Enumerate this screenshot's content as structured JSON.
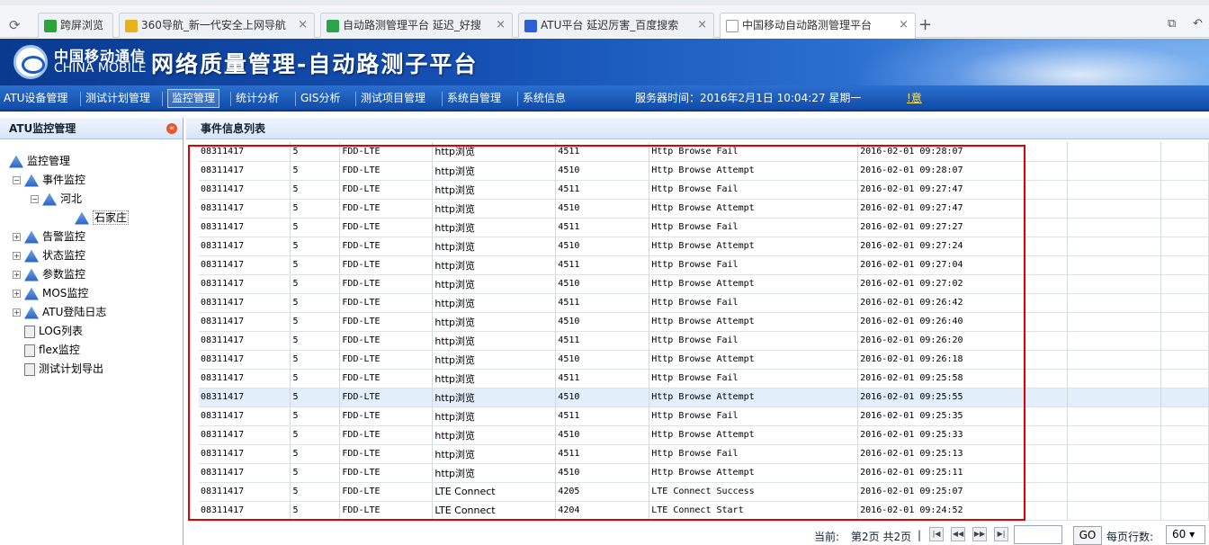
{
  "browser": {
    "tabs": [
      {
        "label": "跨屏浏览",
        "color": "#2ca33b"
      },
      {
        "label": "360导航_新一代安全上网导航",
        "color": "#e8b21a"
      },
      {
        "label": "自动路测管理平台 延迟_好搜",
        "color": "#2ea24a"
      },
      {
        "label": "ATU平台 延迟厉害_百度搜索",
        "color": "#2b5fd6"
      },
      {
        "label": "中国移动自动路测管理平台",
        "color": "#ffffff"
      }
    ]
  },
  "banner": {
    "brand_cn": "中国移动通信",
    "brand_en": "CHINA MOBILE",
    "title": "网络质量管理-自动路测子平台"
  },
  "menu": {
    "items": [
      "ATU设备管理",
      "测试计划管理",
      "监控管理",
      "统计分析",
      "GIS分析",
      "测试项目管理",
      "系统自管理",
      "系统信息"
    ],
    "selected": "监控管理",
    "server_time": "服务器时间：2016年2月1日 10:04:27 星期一",
    "warning": "!意"
  },
  "sidebar": {
    "title": "ATU监控管理",
    "tree": [
      {
        "label": "监控管理",
        "icon": "network-icon",
        "exp": ""
      },
      {
        "label": "事件监控",
        "icon": "network-icon",
        "exp": "−"
      },
      {
        "label": "河北",
        "icon": "network-icon",
        "exp": "−"
      },
      {
        "label": "石家庄",
        "icon": "network-icon",
        "exp": ""
      },
      {
        "label": "告警监控",
        "icon": "network-icon",
        "exp": "+"
      },
      {
        "label": "状态监控",
        "icon": "network-icon",
        "exp": "+"
      },
      {
        "label": "参数监控",
        "icon": "network-icon",
        "exp": "+"
      },
      {
        "label": "MOS监控",
        "icon": "network-icon",
        "exp": "+"
      },
      {
        "label": "ATU登陆日志",
        "icon": "network-icon",
        "exp": "+"
      },
      {
        "label": "LOG列表",
        "icon": "document-icon",
        "exp": ""
      },
      {
        "label": "flex监控",
        "icon": "document-icon",
        "exp": ""
      },
      {
        "label": "测试计划导出",
        "icon": "document-icon",
        "exp": ""
      }
    ]
  },
  "content": {
    "title": "事件信息列表",
    "rows": [
      [
        "08311417",
        "5",
        "FDD-LTE",
        "http浏览",
        "4511",
        "Http Browse Fail",
        "2016-02-01 09:28:07"
      ],
      [
        "08311417",
        "5",
        "FDD-LTE",
        "http浏览",
        "4510",
        "Http Browse Attempt",
        "2016-02-01 09:28:07"
      ],
      [
        "08311417",
        "5",
        "FDD-LTE",
        "http浏览",
        "4511",
        "Http Browse Fail",
        "2016-02-01 09:27:47"
      ],
      [
        "08311417",
        "5",
        "FDD-LTE",
        "http浏览",
        "4510",
        "Http Browse Attempt",
        "2016-02-01 09:27:47"
      ],
      [
        "08311417",
        "5",
        "FDD-LTE",
        "http浏览",
        "4511",
        "Http Browse Fail",
        "2016-02-01 09:27:27"
      ],
      [
        "08311417",
        "5",
        "FDD-LTE",
        "http浏览",
        "4510",
        "Http Browse Attempt",
        "2016-02-01 09:27:24"
      ],
      [
        "08311417",
        "5",
        "FDD-LTE",
        "http浏览",
        "4511",
        "Http Browse Fail",
        "2016-02-01 09:27:04"
      ],
      [
        "08311417",
        "5",
        "FDD-LTE",
        "http浏览",
        "4510",
        "Http Browse Attempt",
        "2016-02-01 09:27:02"
      ],
      [
        "08311417",
        "5",
        "FDD-LTE",
        "http浏览",
        "4511",
        "Http Browse Fail",
        "2016-02-01 09:26:42"
      ],
      [
        "08311417",
        "5",
        "FDD-LTE",
        "http浏览",
        "4510",
        "Http Browse Attempt",
        "2016-02-01 09:26:40"
      ],
      [
        "08311417",
        "5",
        "FDD-LTE",
        "http浏览",
        "4511",
        "Http Browse Fail",
        "2016-02-01 09:26:20"
      ],
      [
        "08311417",
        "5",
        "FDD-LTE",
        "http浏览",
        "4510",
        "Http Browse Attempt",
        "2016-02-01 09:26:18"
      ],
      [
        "08311417",
        "5",
        "FDD-LTE",
        "http浏览",
        "4511",
        "Http Browse Fail",
        "2016-02-01 09:25:58"
      ],
      [
        "08311417",
        "5",
        "FDD-LTE",
        "http浏览",
        "4510",
        "Http Browse Attempt",
        "2016-02-01 09:25:55"
      ],
      [
        "08311417",
        "5",
        "FDD-LTE",
        "http浏览",
        "4511",
        "Http Browse Fail",
        "2016-02-01 09:25:35"
      ],
      [
        "08311417",
        "5",
        "FDD-LTE",
        "http浏览",
        "4510",
        "Http Browse Attempt",
        "2016-02-01 09:25:33"
      ],
      [
        "08311417",
        "5",
        "FDD-LTE",
        "http浏览",
        "4511",
        "Http Browse Fail",
        "2016-02-01 09:25:13"
      ],
      [
        "08311417",
        "5",
        "FDD-LTE",
        "http浏览",
        "4510",
        "Http Browse Attempt",
        "2016-02-01 09:25:11"
      ],
      [
        "08311417",
        "5",
        "FDD-LTE",
        "LTE Connect",
        "4205",
        "LTE Connect Success",
        "2016-02-01 09:25:07"
      ],
      [
        "08311417",
        "5",
        "FDD-LTE",
        "LTE Connect",
        "4204",
        "LTE Connect Start",
        "2016-02-01 09:24:52"
      ]
    ],
    "highlighted_row": 13
  },
  "pager": {
    "current_label": "当前:",
    "page_text": "第2页 共2页",
    "sep": "|",
    "go_label": "GO",
    "rows_per_page_label": "每页行数:",
    "rows_per_page": "60"
  }
}
